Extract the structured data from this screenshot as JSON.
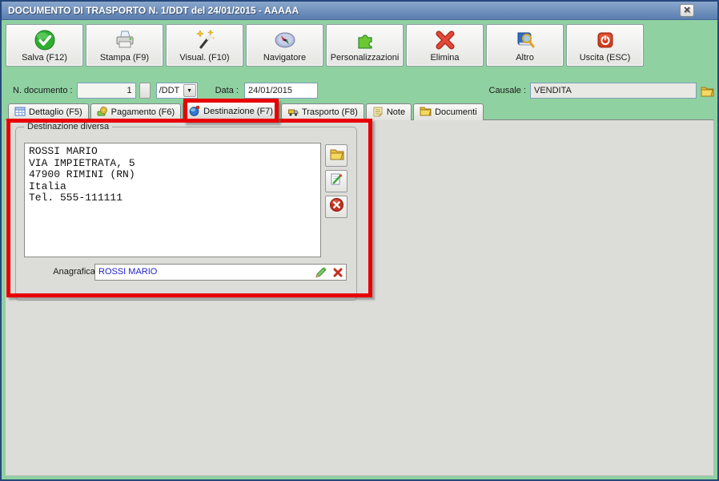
{
  "window": {
    "title": "DOCUMENTO DI TRASPORTO N. 1/DDT del 24/01/2015 - AAAAA",
    "close_label": "x"
  },
  "toolbar": {
    "buttons": [
      {
        "label": "Salva (F12)",
        "icon": "green-check-circle-icon"
      },
      {
        "label": "Stampa (F9)",
        "icon": "printer-icon"
      },
      {
        "label": "Visual. (F10)",
        "icon": "magic-wand-icon"
      },
      {
        "label": "Navigatore",
        "icon": "compass-icon"
      },
      {
        "label": "Personalizzazioni",
        "icon": "green-puzzle-icon"
      },
      {
        "label": "Elimina",
        "icon": "red-x-icon"
      },
      {
        "label": "Altro",
        "icon": "book-magnifier-icon"
      },
      {
        "label": "Uscita (ESC)",
        "icon": "power-icon"
      }
    ]
  },
  "document_bar": {
    "number_label": "N. documento :",
    "number_value": "1",
    "type_value": "/DDT",
    "date_label": "Data :",
    "date_value": "24/01/2015",
    "causale_label": "Causale :",
    "causale_value": "VENDITA"
  },
  "tabs": [
    {
      "label": "Dettaglio (F5)",
      "icon": "table-grid-icon",
      "active": false
    },
    {
      "label": "Pagamento (F6)",
      "icon": "coins-icon",
      "active": false
    },
    {
      "label": "Destinazione (F7)",
      "icon": "globe-icon",
      "active": true
    },
    {
      "label": "Trasporto (F8)",
      "icon": "truck-icon",
      "active": false
    },
    {
      "label": "Note",
      "icon": "note-icon",
      "active": false
    },
    {
      "label": "Documenti",
      "icon": "folder-icon",
      "active": false
    }
  ],
  "destination_panel": {
    "group_title": "Destinazione diversa",
    "address_text": "ROSSI MARIO\nVIA IMPIETRATA, 5\n47900 RIMINI (RN)\nItalia\nTel. 555-111111",
    "anagrafica_label": "Anagrafica :",
    "anagrafica_value": "ROSSI MARIO",
    "side_buttons": [
      "open-folder-icon",
      "edit-sheet-icon",
      "delete-circle-icon"
    ],
    "anagrafica_icons": [
      "green-pencil-icon",
      "red-x-small-icon"
    ]
  },
  "colors": {
    "window_green": "#8FD1A1",
    "titlebar_top": "#8AA7CC",
    "titlebar_bottom": "#5A7EB0",
    "panel_gray": "#DCDCD9",
    "annotation_red": "#E80000",
    "anagrafica_text": "#2222CC"
  }
}
